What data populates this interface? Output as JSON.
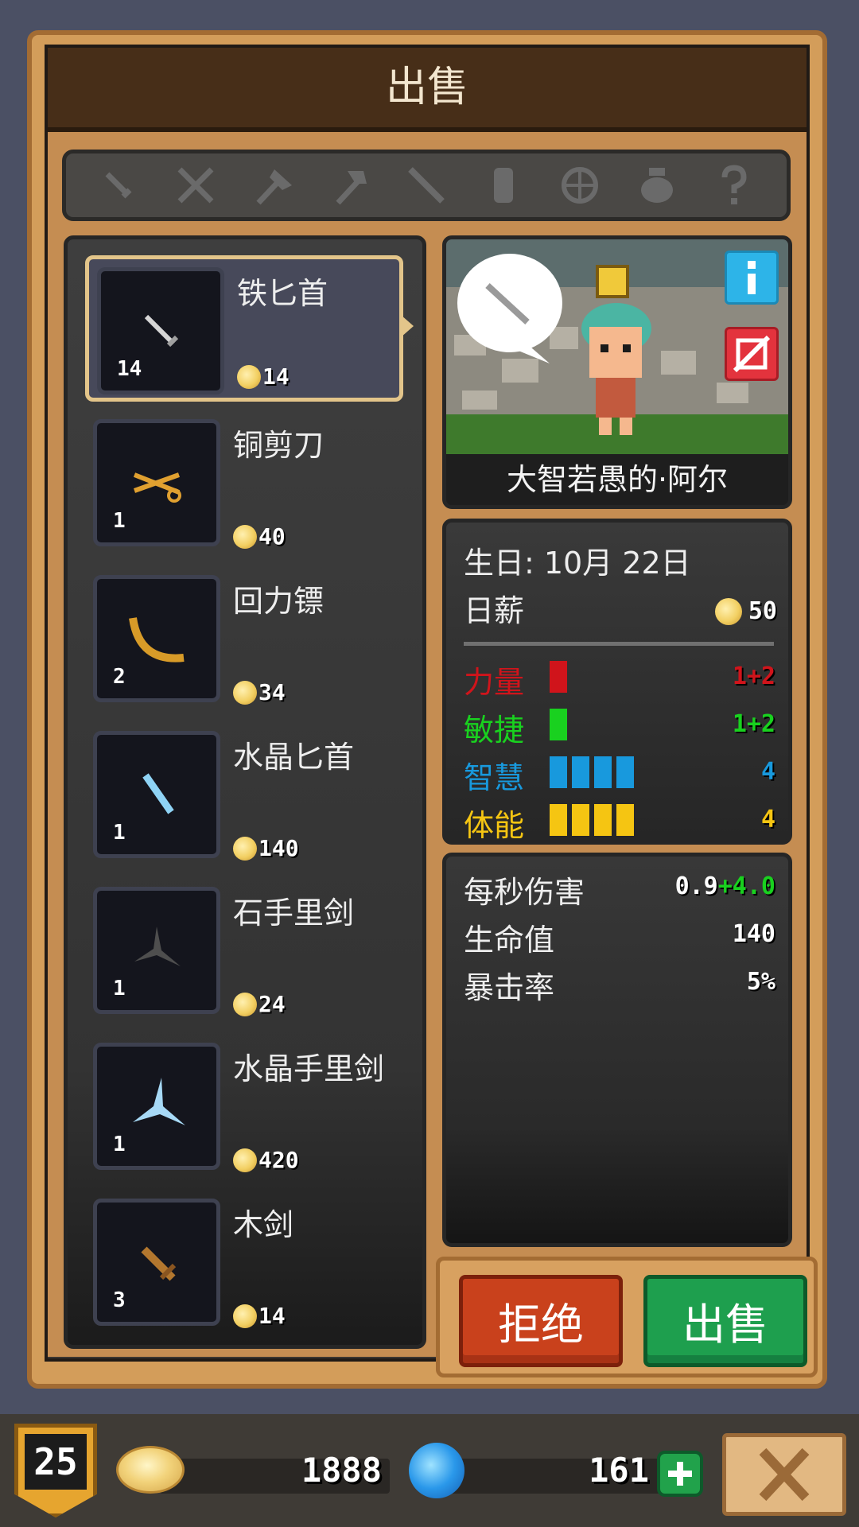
{
  "dialog": {
    "title": "出售"
  },
  "filter_tabs": [
    {
      "icon": "dagger-icon"
    },
    {
      "icon": "crossed-swords-icon"
    },
    {
      "icon": "axe-icon"
    },
    {
      "icon": "hammer-icon"
    },
    {
      "icon": "spear-icon"
    },
    {
      "icon": "armor-icon"
    },
    {
      "icon": "bow-icon"
    },
    {
      "icon": "pot-icon"
    },
    {
      "icon": "question-icon"
    }
  ],
  "items": [
    {
      "name": "铁匕首",
      "qty": "14",
      "price": "14",
      "icon": "iron-dagger-icon",
      "selected": true
    },
    {
      "name": "铜剪刀",
      "qty": "1",
      "price": "40",
      "icon": "copper-scissors-icon"
    },
    {
      "name": "回力镖",
      "qty": "2",
      "price": "34",
      "icon": "boomerang-icon"
    },
    {
      "name": "水晶匕首",
      "qty": "1",
      "price": "140",
      "icon": "crystal-dagger-icon"
    },
    {
      "name": "石手里剑",
      "qty": "1",
      "price": "24",
      "icon": "stone-shuriken-icon"
    },
    {
      "name": "水晶手里剑",
      "qty": "1",
      "price": "420",
      "icon": "crystal-shuriken-icon"
    },
    {
      "name": "木剑",
      "qty": "3",
      "price": "14",
      "icon": "wooden-sword-icon"
    }
  ],
  "hero": {
    "name": "大智若愚的·阿尔",
    "birthday": "生日:  10月 22日",
    "salary_label": "日薪",
    "salary": "50"
  },
  "stats": [
    {
      "label": "力量",
      "bars": 1,
      "value": "1+2",
      "color": "#d0141b"
    },
    {
      "label": "敏捷",
      "bars": 1,
      "value": "1+2",
      "color": "#19d11f"
    },
    {
      "label": "智慧",
      "bars": 4,
      "value": "4",
      "color": "#1899dd"
    },
    {
      "label": "体能",
      "bars": 4,
      "value": "4",
      "color": "#f5c512"
    }
  ],
  "combat": {
    "dps_label": "每秒伤害",
    "dps_base": "0.9",
    "dps_bonus": "+4.0",
    "hp_label": "生命值",
    "hp": "140",
    "crit_label": "暴击率",
    "crit": "5%"
  },
  "actions": {
    "reject": "拒绝",
    "sell": "出售"
  },
  "footer": {
    "level": "25",
    "gold": "1888",
    "gems": "161"
  }
}
